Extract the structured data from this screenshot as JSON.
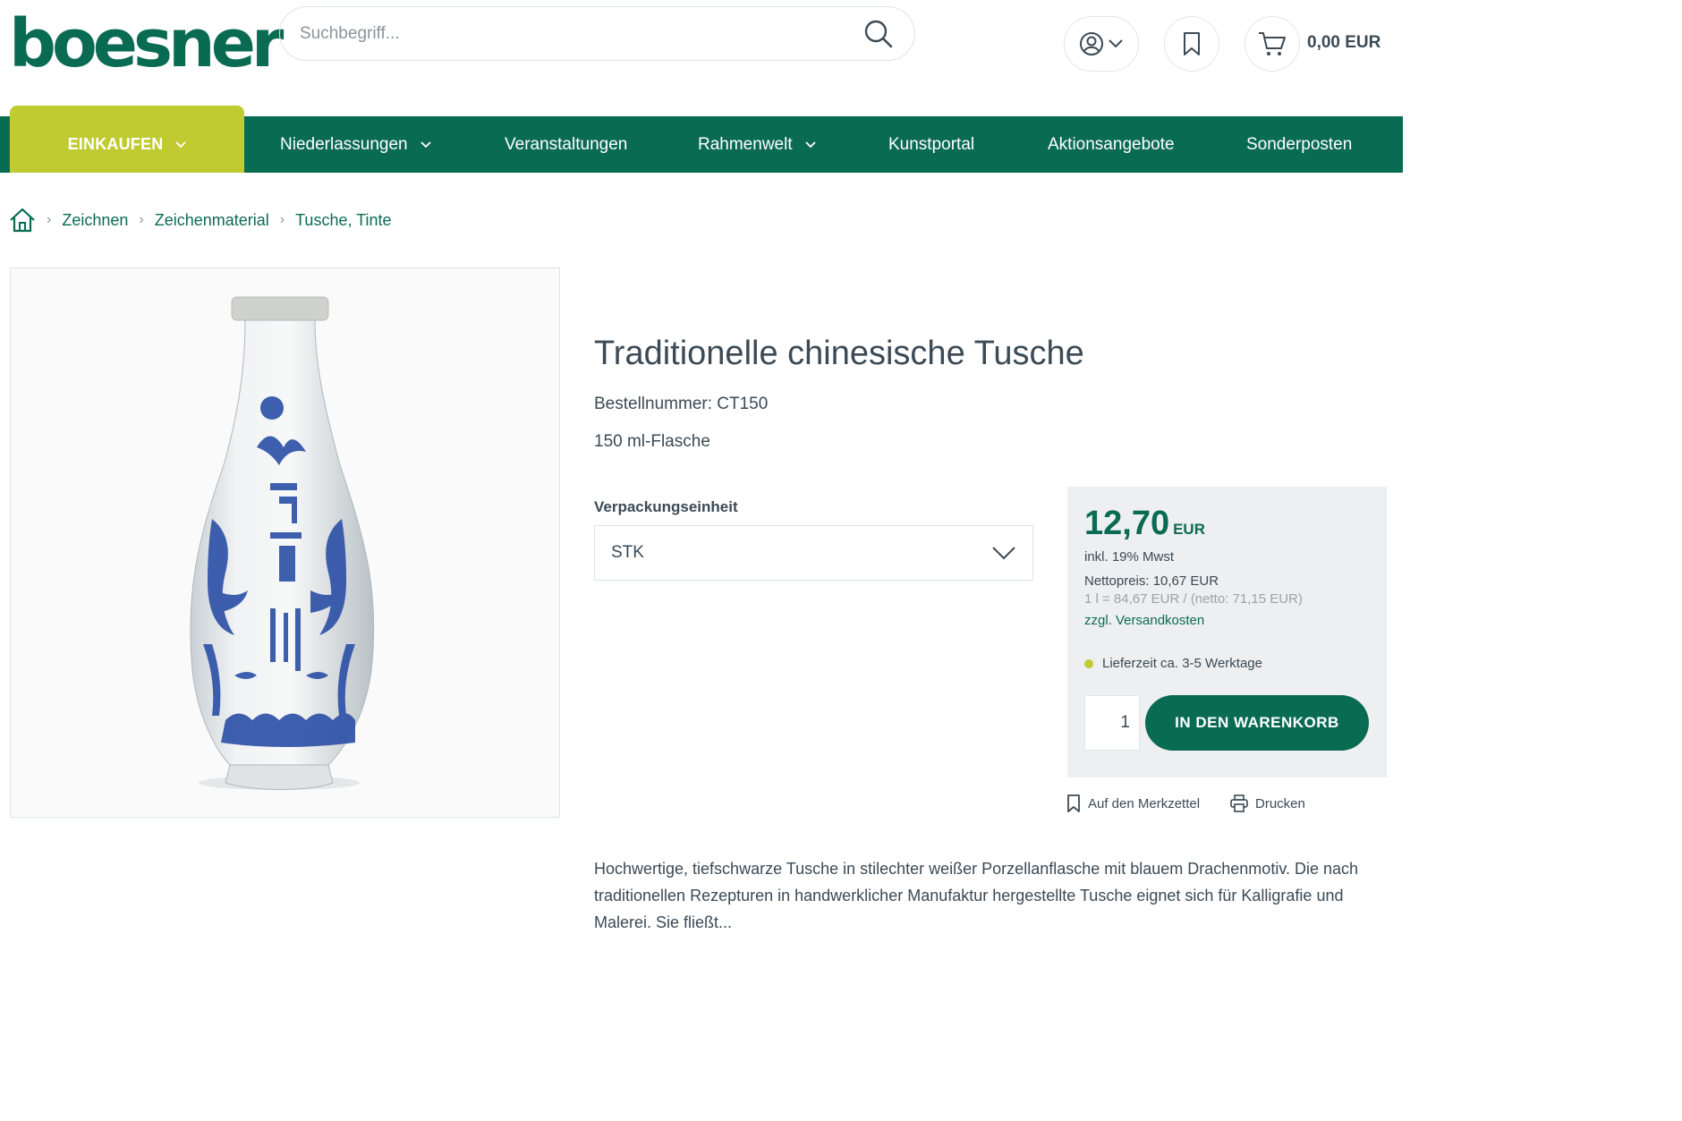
{
  "header": {
    "logo": "boesner",
    "search_placeholder": "Suchbegriff...",
    "cart_total": "0,00 EUR"
  },
  "nav": {
    "shop": "EINKAUFEN",
    "items": [
      "Niederlassungen",
      "Veranstaltungen",
      "Rahmenwelt",
      "Kunstportal",
      "Aktionsangebote",
      "Sonderposten"
    ]
  },
  "breadcrumb": [
    "Zeichnen",
    "Zeichenmaterial",
    "Tusche, Tinte"
  ],
  "product": {
    "title": "Traditionelle chinesische Tusche",
    "order_number": "Bestellnummer: CT150",
    "size": "150 ml-Flasche",
    "packaging_label": "Verpackungseinheit",
    "packaging_value": "STK",
    "description": "Hochwertige, tiefschwarze Tusche in stilechter weißer Porzellanflasche mit blauem Drachenmotiv. Die nach traditionellen Rezepturen in handwerklicher Manufaktur hergestellte Tusche eignet sich für Kalligrafie und Malerei. Sie fließt..."
  },
  "pricebox": {
    "price": "12,70",
    "currency": "EUR",
    "vat": "inkl. 19% Mwst",
    "net": "Nettopreis: 10,67 EUR",
    "unit_price": "1 l = 84,67 EUR / (netto: 71,15 EUR)",
    "shipping": "zzgl. Versandkosten",
    "delivery": "Lieferzeit ca. 3-5 Werktage",
    "quantity": "1",
    "add_to_cart": "IN DEN WARENKORB"
  },
  "actions": {
    "wishlist": "Auf den Merkzettel",
    "print": "Drucken"
  },
  "colors": {
    "brand_green": "#0a6b53",
    "lime": "#bfcb31"
  }
}
